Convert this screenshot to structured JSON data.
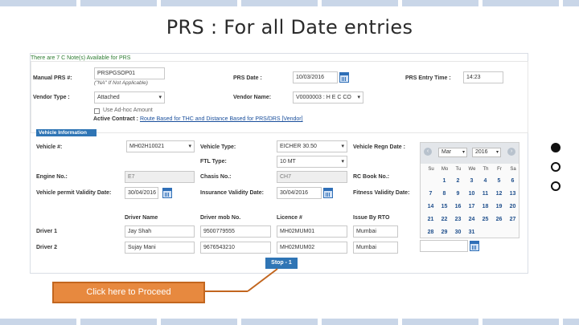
{
  "slide": {
    "title": "PRS : For all Date entries",
    "proceed_label": "Click here to Proceed"
  },
  "form": {
    "availability_note": "There are 7 C Note(s) Available for PRS",
    "manual_prs": {
      "label": "Manual PRS #:",
      "value": "PRSPGSOP01",
      "hint": "(\"NA\" If Not Applicable)"
    },
    "prs_date": {
      "label": "PRS Date :",
      "value": "10/03/2016"
    },
    "prs_entry_time": {
      "label": "PRS Entry Time :",
      "value": "14:23"
    },
    "vendor_type": {
      "label": "Vendor Type :",
      "value": "Attached"
    },
    "vendor_name": {
      "label": "Vendor Name:",
      "value": "V0000003 : H E C CO"
    },
    "adhoc_label": "Use Ad-hoc Amount",
    "active_contract": {
      "label": "Active Contract :",
      "value": "Route Based for THC and Distance Based for PRS/DRS [Vendor]"
    },
    "section_title": "Vehicle Information",
    "vehicle_no": {
      "label": "Vehicle #:",
      "value": "MH02H10021"
    },
    "vehicle_type": {
      "label": "Vehicle Type:",
      "value": "EICHER 30.50"
    },
    "vehicle_regn_date": {
      "label": "Vehicle Regn Date :"
    },
    "ftl_type": {
      "label": "FTL Type:",
      "value": "10 MT"
    },
    "engine_no": {
      "label": "Engine No.:",
      "value": "E7"
    },
    "chasis_no": {
      "label": "Chasis No.:",
      "value": "CH7"
    },
    "rc_book_no": {
      "label": "RC Book No.:"
    },
    "permit_validity": {
      "label": "Vehicle permit Validity Date:",
      "value": "30/04/2016"
    },
    "insurance_validity": {
      "label": "Insurance Validity Date:",
      "value": "30/04/2016"
    },
    "fitness_validity": {
      "label": "Fitness Validity Date:"
    },
    "driver_headers": [
      "Driver Name",
      "Driver mob No.",
      "Licence #",
      "Issue By RTO"
    ],
    "drivers": [
      {
        "label": "Driver 1",
        "name": "Jay Shah",
        "mobile": "9500779555",
        "licence": "MH02MUM01",
        "rto": "Mumbai"
      },
      {
        "label": "Driver 2",
        "name": "Sujay Mani",
        "mobile": "9676543210",
        "licence": "MH02MUM02",
        "rto": "Mumbai"
      }
    ],
    "stop_label": "Stop - 1"
  },
  "calendar": {
    "month": "Mar",
    "year": "2016",
    "prev_icon": "chevron-left-icon",
    "next_icon": "chevron-right-icon",
    "weekdays": [
      "Su",
      "Mo",
      "Tu",
      "We",
      "Th",
      "Fr",
      "Sa"
    ],
    "days": [
      "1",
      "2",
      "3",
      "4",
      "5",
      "6",
      "7",
      "8",
      "9",
      "10",
      "11",
      "12",
      "13",
      "14",
      "15",
      "16",
      "17",
      "18",
      "19",
      "20",
      "21",
      "22",
      "23",
      "24",
      "25",
      "26",
      "27",
      "28",
      "29",
      "30",
      "31"
    ],
    "first_weekday_index": 1
  },
  "colors": {
    "accent": "#2f75b5",
    "proceed_bg": "#e7893f",
    "proceed_border": "#c2661f",
    "pointer_line": "#c2661f"
  }
}
